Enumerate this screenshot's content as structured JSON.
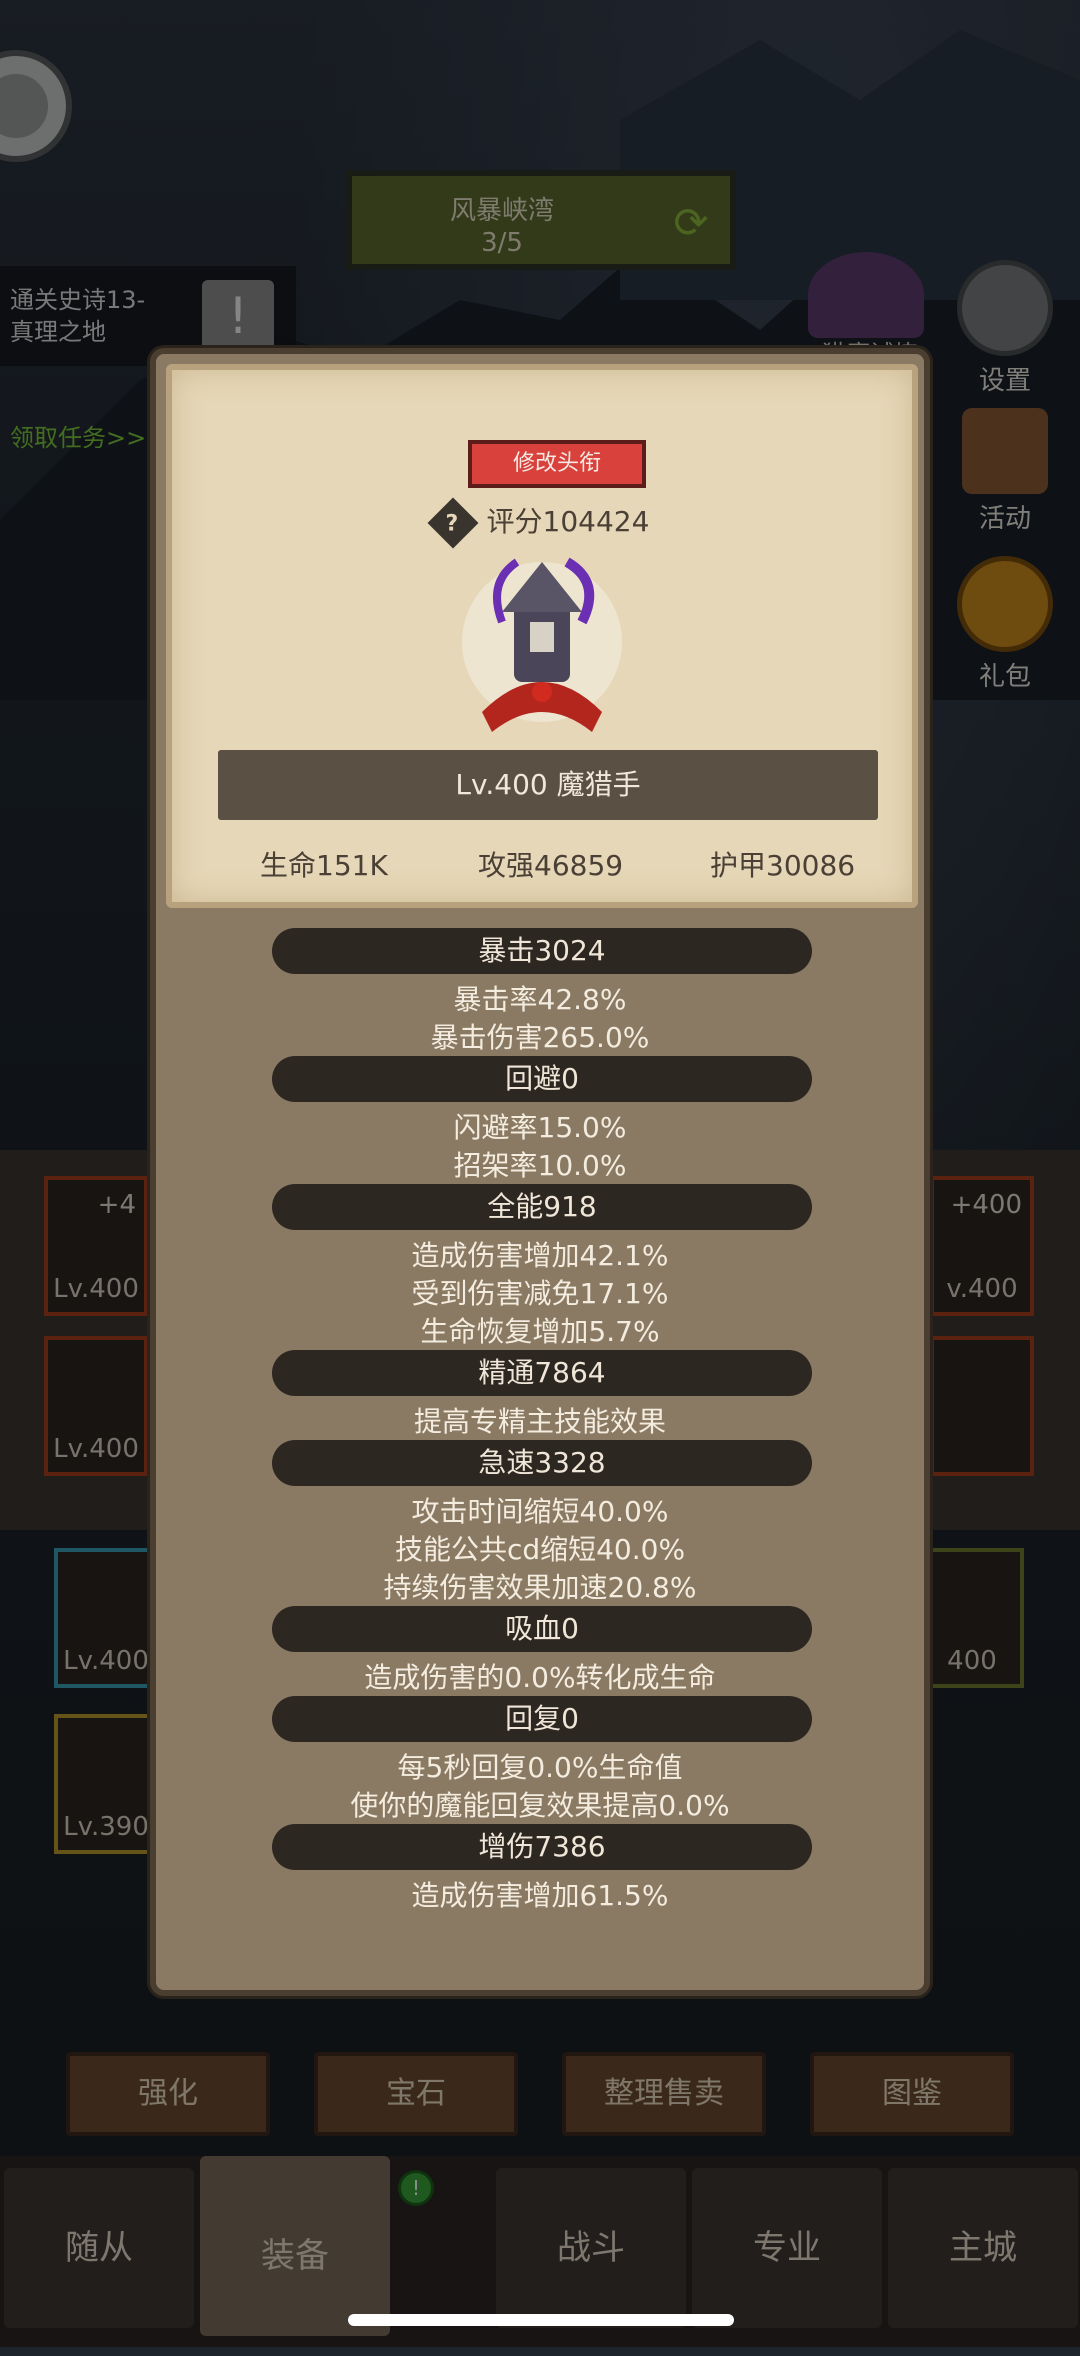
{
  "stage": {
    "name": "风暴峡湾",
    "progress": "3/5"
  },
  "quest": {
    "text_line1": "通关史诗13-",
    "text_line2": "真理之地",
    "link": "领取任务>>"
  },
  "right_menu": {
    "hunt_trial": "猎魔试炼",
    "settings": "设置",
    "activity": "活动",
    "gift": "礼包"
  },
  "equipment_bg": {
    "left_slots": [
      {
        "plus": "+4",
        "level": "Lv.400"
      },
      {
        "level": "Lv.400"
      }
    ],
    "right_slots": [
      {
        "plus": "+400",
        "level": "v.400"
      }
    ],
    "lower_left": [
      {
        "level": "Lv.400"
      },
      {
        "level": "Lv.390"
      }
    ],
    "lower_right": [
      {
        "level": "400"
      }
    ],
    "hp_tags": [
      "400",
      "400"
    ]
  },
  "bottom_buttons": [
    "强化",
    "宝石",
    "整理售卖",
    "图鉴"
  ],
  "tabs": [
    "随从",
    "装备",
    "战斗",
    "专业",
    "主城"
  ],
  "modal": {
    "title_button": "修改头衔",
    "score": "评分104424",
    "help_symbol": "?",
    "char_name": "Lv.400 魔猎手",
    "main_stats": {
      "life": "生命151K",
      "attack": "攻强46859",
      "armor": "护甲30086"
    },
    "sections": [
      {
        "head": "暴击3024",
        "lines": [
          "暴击率42.8%",
          "暴击伤害265.0%"
        ]
      },
      {
        "head": "回避0",
        "lines": [
          "闪避率15.0%",
          "招架率10.0%"
        ]
      },
      {
        "head": "全能918",
        "lines": [
          "造成伤害增加42.1%",
          "受到伤害减免17.1%",
          "生命恢复增加5.7%"
        ]
      },
      {
        "head": "精通7864",
        "lines": [
          "提高专精主技能效果"
        ]
      },
      {
        "head": "急速3328",
        "lines": [
          "攻击时间缩短40.0%",
          "技能公共cd缩短40.0%",
          "持续伤害效果加速20.8%"
        ]
      },
      {
        "head": "吸血0",
        "lines": [
          "造成伤害的0.0%转化成生命"
        ]
      },
      {
        "head": "回复0",
        "lines": [
          "每5秒回复0.0%生命值",
          "使你的魔能回复效果提高0.0%"
        ]
      },
      {
        "head": "增伤7386",
        "lines": [
          "造成伤害增加61.5%"
        ]
      }
    ]
  }
}
